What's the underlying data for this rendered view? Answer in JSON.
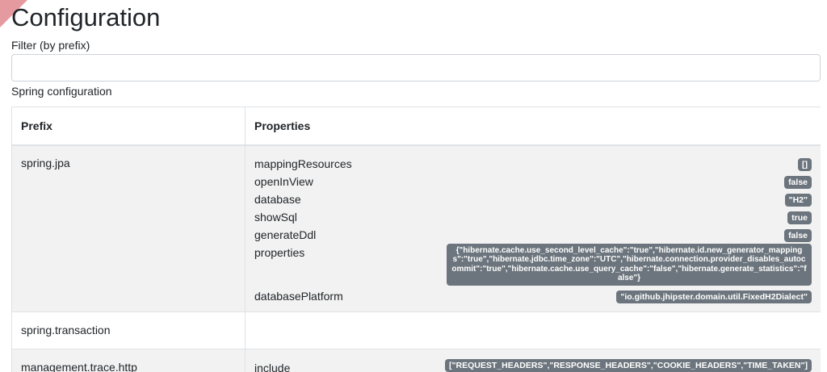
{
  "page": {
    "title": "Configuration",
    "filter_label": "Filter (by prefix)",
    "filter_value": "",
    "section_label": "Spring configuration"
  },
  "table": {
    "headers": {
      "prefix": "Prefix",
      "properties": "Properties"
    },
    "rows": [
      {
        "prefix": "spring.jpa",
        "props": [
          {
            "name": "mappingResources",
            "value": "[]"
          },
          {
            "name": "openInView",
            "value": "false"
          },
          {
            "name": "database",
            "value": "\"H2\""
          },
          {
            "name": "showSql",
            "value": "true"
          },
          {
            "name": "generateDdl",
            "value": "false"
          },
          {
            "name": "properties",
            "value": "{\"hibernate.cache.use_second_level_cache\":\"true\",\"hibernate.id.new_generator_mappings\":\"true\",\"hibernate.jdbc.time_zone\":\"UTC\",\"hibernate.connection.provider_disables_autocommit\":\"true\",\"hibernate.cache.use_query_cache\":\"false\",\"hibernate.generate_statistics\":\"false\"}"
          },
          {
            "name": "databasePlatform",
            "value": "\"io.github.jhipster.domain.util.FixedH2Dialect\""
          }
        ]
      },
      {
        "prefix": "spring.transaction",
        "props": []
      },
      {
        "prefix": "management.trace.http",
        "props": [
          {
            "name": "include",
            "value": "[\"REQUEST_HEADERS\",\"RESPONSE_HEADERS\",\"COOKIE_HEADERS\",\"TIME_TAKEN\"]"
          }
        ]
      }
    ]
  },
  "colors": {
    "badge": "#6c757d",
    "stripe": "#f2f2f2",
    "border": "#dee2e6",
    "ribbon": "#e59aa0"
  }
}
